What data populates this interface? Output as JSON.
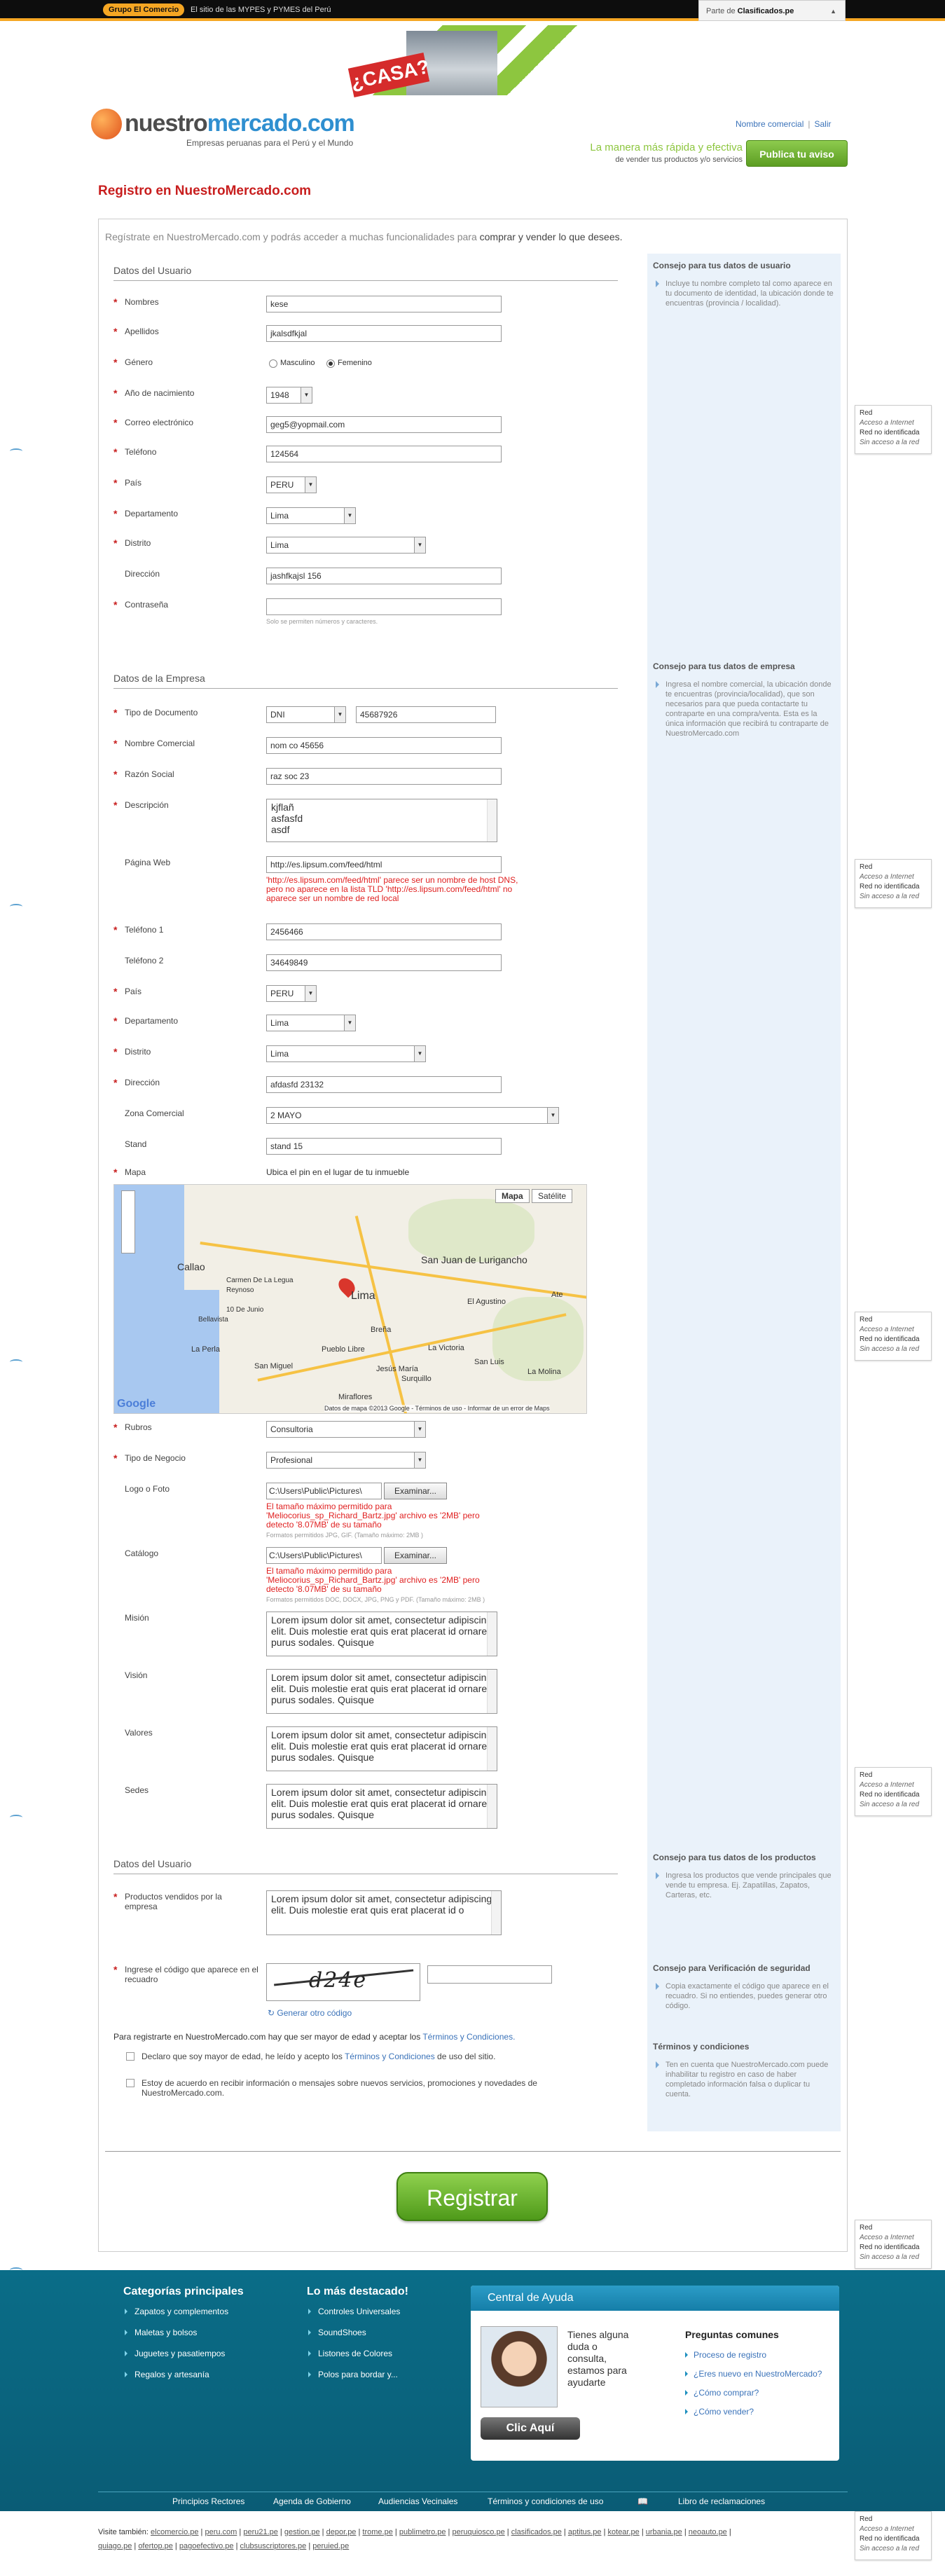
{
  "topbar": {
    "brand": "Grupo El Comercio",
    "tagline": "El sitio de las MYPES y PYMES del Perú",
    "parte_de": "Parte de",
    "clasificados": "Clasificados.pe"
  },
  "banner": {
    "text": "¿CASA?"
  },
  "logo": {
    "name_a": "nuestro",
    "name_b": "mercado.com",
    "sub": "Empresas peruanas para el Perú y el Mundo"
  },
  "header": {
    "user": "Nombre comercial",
    "logout": "Salir",
    "promo_l1": "La manera más rápida y efectiva",
    "promo_l2": "de vender tus productos y/o servicios",
    "publish_btn": "Publica tu aviso"
  },
  "page_title": "Registro en NuestroMercado.com",
  "intro": {
    "a": "Regístrate en NuestroMercado.com y podrás acceder a muchas funcionalidades para ",
    "b": "comprar y vender lo que desees."
  },
  "usuario": {
    "title": "Datos del Usuario",
    "nombres": {
      "label": "Nombres",
      "value": "kese"
    },
    "apellidos": {
      "label": "Apellidos",
      "value": "jkalsdfkjal"
    },
    "genero": {
      "label": "Género",
      "opt1": "Masculino",
      "opt2": "Femenino",
      "selected": "Femenino"
    },
    "nacimiento": {
      "label": "Año de nacimiento",
      "value": "1948"
    },
    "correo": {
      "label": "Correo electrónico",
      "value": "geg5@yopmail.com"
    },
    "telefono": {
      "label": "Teléfono",
      "value": "124564"
    },
    "pais": {
      "label": "País",
      "value": "PERU"
    },
    "departamento": {
      "label": "Departamento",
      "value": "Lima"
    },
    "distrito": {
      "label": "Distrito",
      "value": "Lima"
    },
    "direccion": {
      "label": "Dirección",
      "value": "jashfkajsl 156"
    },
    "contrasena": {
      "label": "Contraseña",
      "value": "",
      "hint": "Solo se permiten números y caracteres."
    }
  },
  "empresa": {
    "title": "Datos de la Empresa",
    "tipo_doc": {
      "label": "Tipo de Documento",
      "type": "DNI",
      "value": "45687926"
    },
    "nombre_comercial": {
      "label": "Nombre Comercial",
      "value": "nom co 45656"
    },
    "razon_social": {
      "label": "Razón Social",
      "value": "raz soc 23"
    },
    "descripcion": {
      "label": "Descripción",
      "lines": [
        "kjflañ",
        "asfasfd",
        "asdf"
      ]
    },
    "web": {
      "label": "Página Web",
      "value": "http://es.lipsum.com/feed/html",
      "error": "'http://es.lipsum.com/feed/html' parece ser un nombre de host DNS, pero no aparece en la lista TLD 'http://es.lipsum.com/feed/html' no aparece ser un nombre de red local"
    },
    "telefono1": {
      "label": "Teléfono 1",
      "value": "2456466"
    },
    "telefono2": {
      "label": "Teléfono 2",
      "value": "34649849"
    },
    "pais": {
      "label": "País",
      "value": "PERU"
    },
    "departamento": {
      "label": "Departamento",
      "value": "Lima"
    },
    "distrito": {
      "label": "Distrito",
      "value": "Lima"
    },
    "direccion": {
      "label": "Dirección",
      "value": "afdasfd 23132"
    },
    "zona": {
      "label": "Zona Comercial",
      "value": "2 MAYO"
    },
    "stand": {
      "label": "Stand",
      "value": "stand 15"
    },
    "mapa": {
      "label": "Mapa",
      "hint": "Ubica el pin en el lugar de tu inmueble",
      "btn_map": "Mapa",
      "btn_sat": "Satélite",
      "city": "Lima",
      "places": [
        "Callao",
        "San Juan de Lurigancho",
        "La Molina",
        "Miraflores",
        "San Miguel",
        "Pueblo Libre",
        "Jesús María",
        "Breña",
        "La Victoria",
        "San Luis",
        "El Agustino",
        "La Perla",
        "Bellavista",
        "Carmen De La Legua Reynoso",
        "10 De Junio",
        "Ate",
        "Surquillo"
      ],
      "footer": "Datos de mapa ©2013 Google - Términos de uso - Informar de un error de Maps",
      "google": "Google"
    },
    "rubros": {
      "label": "Rubros",
      "value": "Consultoria"
    },
    "tipo_negocio": {
      "label": "Tipo de Negocio",
      "value": "Profesional"
    },
    "logo": {
      "label": "Logo o Foto",
      "value": "C:\\Users\\Public\\Pictures\\",
      "btn": "Examinar...",
      "error": "El tamaño máximo permitido para 'Meliocorius_sp_Richard_Bartz.jpg' archivo es '2MB' pero detecto '8.07MB' de su tamaño",
      "hint": "Formatos permitidos JPG, GIF. (Tamaño máximo: 2MB )"
    },
    "catalogo": {
      "label": "Catálogo",
      "value": "C:\\Users\\Public\\Pictures\\",
      "btn": "Examinar...",
      "error": "El tamaño máximo permitido para 'Meliocorius_sp_Richard_Bartz.jpg' archivo es '2MB' pero detecto '8.07MB' de su tamaño",
      "hint": "Formatos permitidos DOC, DOCX, JPG, PNG y PDF. (Tamaño máximo: 2MB )"
    },
    "lorem": "Lorem ipsum dolor sit amet, consectetur adipiscing elit. Duis molestie erat quis erat placerat id ornare purus sodales. Quisque",
    "mision": {
      "label": "Misión"
    },
    "vision": {
      "label": "Visión"
    },
    "valores": {
      "label": "Valores"
    },
    "sedes": {
      "label": "Sedes"
    }
  },
  "usuario2": {
    "title": "Datos del Usuario",
    "productos": {
      "label": "Productos vendidos por la empresa",
      "value": "Lorem ipsum dolor sit amet, consectetur adipiscing elit. Duis molestie erat quis erat placerat id o"
    },
    "captcha": {
      "label": "Ingrese el código que aparece en el recuadro",
      "code": "d24e",
      "regen": "Generar otro código"
    },
    "legal": {
      "a": "Para registrarte en NuestroMercado.com hay que ser mayor de edad y aceptar los ",
      "link": "Términos y Condiciones."
    },
    "chk1": {
      "a": "Declaro que soy mayor de edad, he leído y acepto los ",
      "link": "Términos y Condiciones",
      "b": " de uso del sitio."
    },
    "chk2": "Estoy de acuerdo en recibir información o mensajes sobre nuevos servicios, promociones y novedades de NuestroMercado.com."
  },
  "register_btn": "Registrar",
  "tips": {
    "usuario": {
      "title": "Consejo para tus datos de usuario",
      "text": "Incluye tu nombre completo tal como aparece en tu documento de identidad, la ubicación donde te encuentras (provincia / localidad)."
    },
    "empresa": {
      "title": "Consejo para tus datos de empresa",
      "text": "Ingresa el nombre comercial, la ubicación donde te encuentras (provincia/localidad), que son necesarios para que pueda contactarte tu contraparte en una compra/venta. Esta es la única información que recibirá tu contraparte de NuestroMercado.com"
    },
    "productos": {
      "title": "Consejo para tus datos de los productos",
      "text": "Ingresa los productos que vende principales que vende tu empresa. Ej. Zapatillas, Zapatos, Carteras, etc."
    },
    "verificacion": {
      "title": "Consejo para Verificación de seguridad",
      "text": "Copia exactamente el código que aparece en el recuadro. Si no entiendes, puedes generar otro código."
    },
    "terminos": {
      "title": "Términos y condiciones",
      "text": "Ten en cuenta que NuestroMercado.com puede inhabilitar tu registro en caso de haber completado información falsa o duplicar tu cuenta."
    }
  },
  "footer": {
    "cat_title": "Categorías principales",
    "cats": [
      "Zapatos y complementos",
      "Maletas y bolsos",
      "Juguetes y pasatiempos",
      "Regalos y artesanía"
    ],
    "dest_title": "Lo más destacado!",
    "dest": [
      "Controles Universales",
      "SoundShoes",
      "Listones de Colores",
      "Polos para bordar y..."
    ],
    "help_title": "Central de Ayuda",
    "help_msg": "Tienes alguna duda o consulta, estamos para ayudarte",
    "help_btn": "Clic Aquí",
    "faq_title": "Preguntas comunes",
    "faq": [
      "Proceso de registro",
      "¿Eres nuevo en NuestroMercado?",
      "¿Cómo comprar?",
      "¿Cómo vender?"
    ],
    "links": [
      "Principios Rectores",
      "Agenda de Gobierno",
      "Audiencias Vecinales",
      "Términos y condiciones de uso",
      "Libro de reclamaciones"
    ],
    "tambien_label": "Visite también:",
    "tambien": [
      "elcomercio.pe",
      "peru.com",
      "peru21.pe",
      "gestion.pe",
      "depor.pe",
      "trome.pe",
      "publimetro.pe",
      "peruquiosco.pe",
      "clasificados.pe",
      "aptitus.pe",
      "kotear.pe",
      "urbania.pe",
      "neoauto.pe",
      "quiago.pe",
      "ofertop.pe",
      "pagoefectivo.pe",
      "clubsuscriptores.pe",
      "peruied.pe"
    ]
  },
  "widget": {
    "l1": "Red",
    "l2": "Acceso a Internet",
    "l3": "Red no identificada",
    "l4": "Sin acceso a la red"
  }
}
